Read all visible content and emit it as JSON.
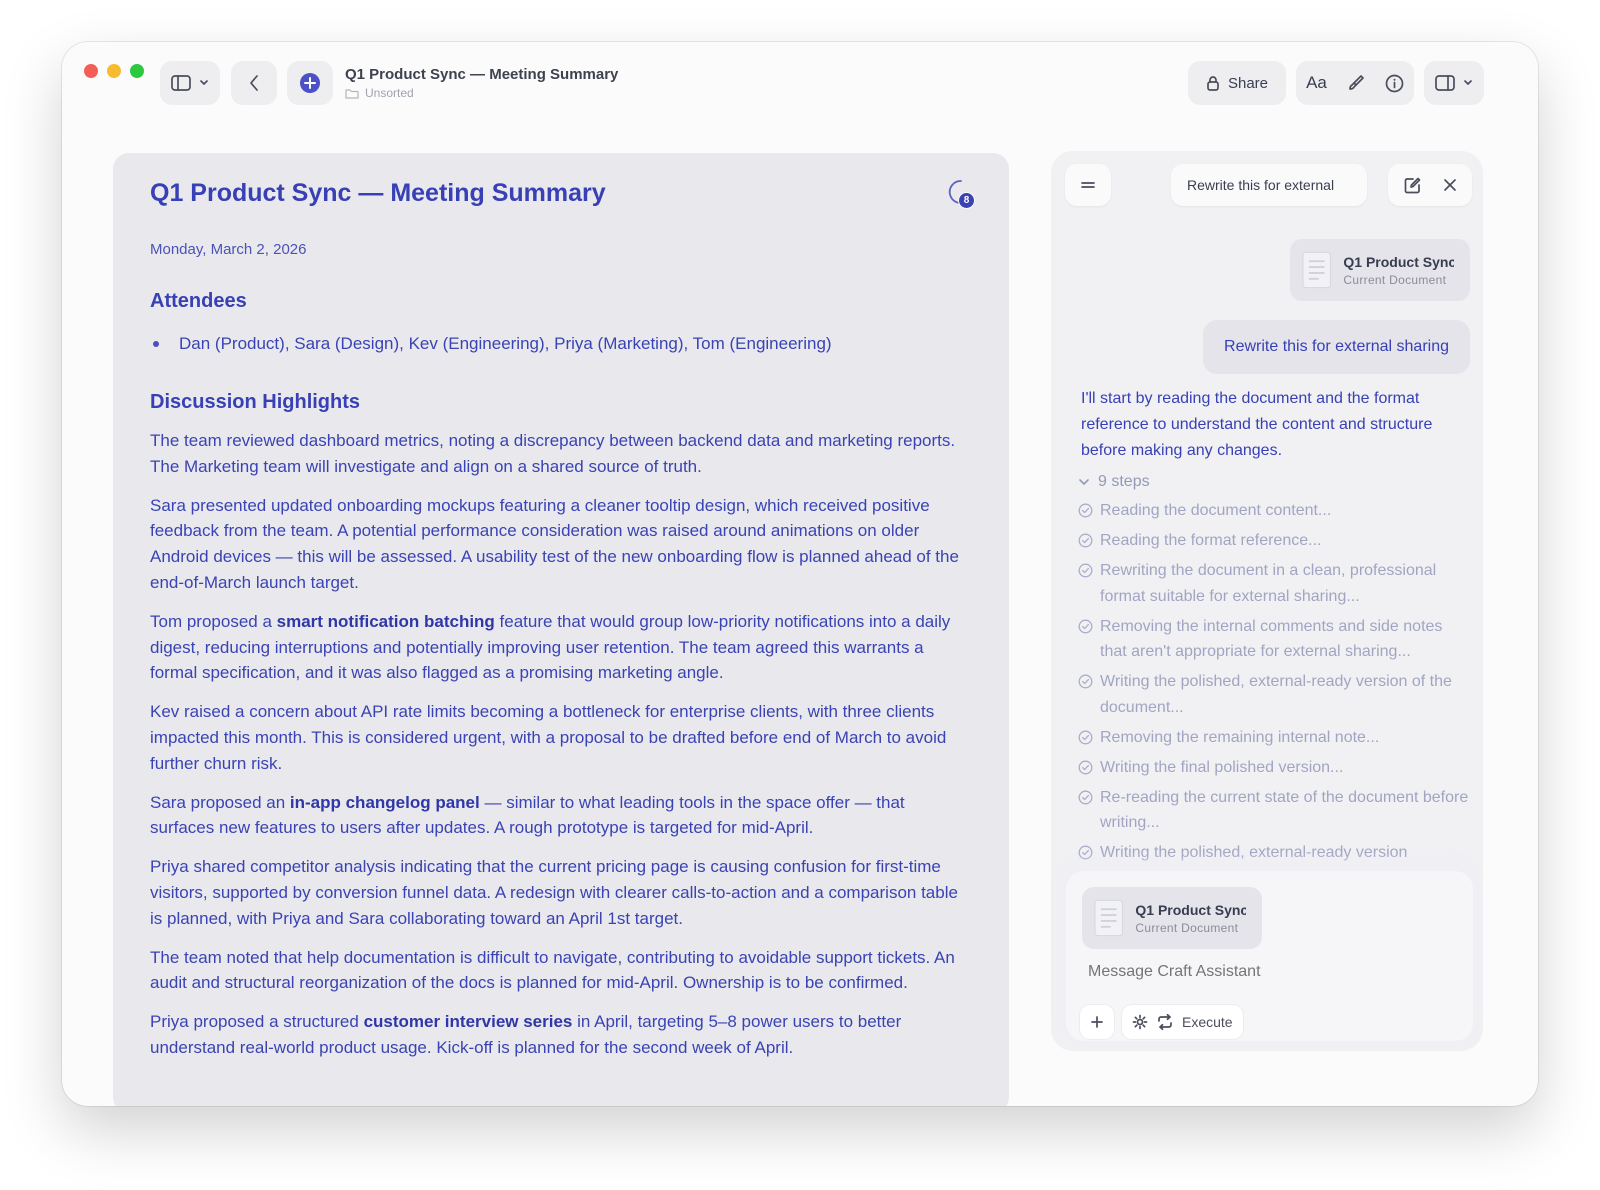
{
  "window": {
    "title": "Q1 Product Sync — Meeting Summary",
    "folder": "Unsorted",
    "traffic_lights": [
      "#f35f57",
      "#f7bb2f",
      "#2bc840"
    ]
  },
  "toolbar": {
    "share_label": "Share",
    "font_label": "Aa"
  },
  "document": {
    "title": "Q1 Product Sync — Meeting Summary",
    "comment_count": "8",
    "date": "Monday, March 2, 2026",
    "attendees_heading": "Attendees",
    "attendees": "Dan (Product), Sara (Design), Kev (Engineering), Priya (Marketing), Tom (Engineering)",
    "discussion_heading": "Discussion Highlights",
    "p1": "The team reviewed dashboard metrics, noting a discrepancy between backend data and marketing reports. The Marketing team will investigate and align on a shared source of truth.",
    "p2": "Sara presented updated onboarding mockups featuring a cleaner tooltip design, which received positive feedback from the team. A potential performance consideration was raised around animations on older Android devices — this will be assessed. A usability test of the new onboarding flow is planned ahead of the end-of-March launch target.",
    "p3_pre": "Tom proposed a ",
    "p3_bold": "smart notification batching",
    "p3_post": " feature that would group low-priority notifications into a daily digest, reducing interruptions and potentially improving user retention. The team agreed this warrants a formal specification, and it was also flagged as a promising marketing angle.",
    "p4": "Kev raised a concern about API rate limits becoming a bottleneck for enterprise clients, with three clients impacted this month. This is considered urgent, with a proposal to be drafted before end of March to avoid further churn risk.",
    "p5_pre": "Sara proposed an ",
    "p5_bold": "in-app changelog panel",
    "p5_post": " — similar to what leading tools in the space offer — that surfaces new features to users after updates. A rough prototype is targeted for mid-April.",
    "p6": "Priya shared competitor analysis indicating that the current pricing page is causing confusion for first-time visitors, supported by conversion funnel data. A redesign with clearer calls-to-action and a comparison table is planned, with Priya and Sara collaborating toward an April 1st target.",
    "p7": "The team noted that help documentation is difficult to navigate, contributing to avoidable support tickets. An audit and structural reorganization of the docs is planned for mid-April. Ownership is to be confirmed.",
    "p8_pre": "Priya proposed a structured ",
    "p8_bold": "customer interview series",
    "p8_post": " in April, targeting 5–8 power users to better understand real-world product usage. Kick-off is planned for the second week of April."
  },
  "assistant": {
    "thread_title": "Rewrite this for external",
    "attachment_title": "Q1 Product Sync",
    "attachment_sub": "Current Document",
    "user_message": "Rewrite this for external sharing",
    "response": "I'll start by reading the document and the format reference to understand the content and structure before making any changes.",
    "steps_label": "9 steps",
    "steps": [
      "Reading the document content...",
      "Reading the format reference...",
      "Rewriting the document in a clean, professional format suitable for external sharing...",
      "Removing the internal comments and side notes that aren't appropriate for external sharing...",
      "Writing the polished, external-ready version of the document...",
      "Removing the remaining internal note...",
      "Writing the final polished version...",
      "Re-reading the current state of the document before writing...",
      "Writing the polished, external-ready version"
    ],
    "composer": {
      "attachment_title": "Q1 Product Sync",
      "attachment_sub": "Current Document",
      "placeholder": "Message Craft Assistant",
      "execute_label": "Execute"
    }
  }
}
